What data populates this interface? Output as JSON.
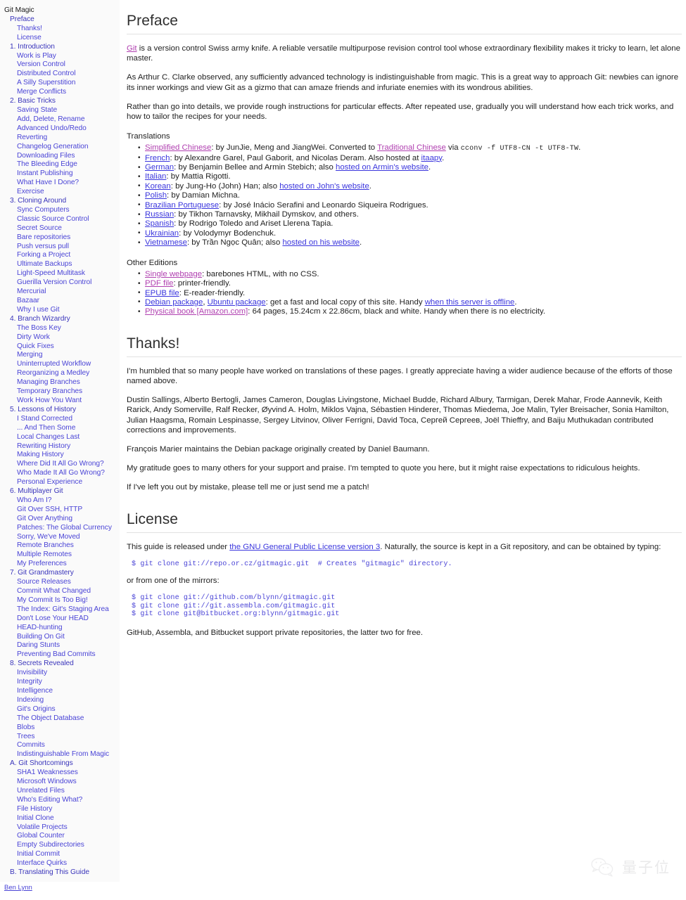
{
  "sidebar": {
    "root_label": "Git Magic",
    "items": [
      {
        "label": "Preface",
        "level": "chapter"
      },
      {
        "label": "Thanks!",
        "level": "section"
      },
      {
        "label": "License",
        "level": "section"
      },
      {
        "label": "1. Introduction",
        "level": "chapter"
      },
      {
        "label": "Work is Play",
        "level": "section"
      },
      {
        "label": "Version Control",
        "level": "section"
      },
      {
        "label": "Distributed Control",
        "level": "section"
      },
      {
        "label": "A Silly Superstition",
        "level": "section"
      },
      {
        "label": "Merge Conflicts",
        "level": "section"
      },
      {
        "label": "2. Basic Tricks",
        "level": "chapter"
      },
      {
        "label": "Saving State",
        "level": "section"
      },
      {
        "label": "Add, Delete, Rename",
        "level": "section"
      },
      {
        "label": "Advanced Undo/Redo",
        "level": "section"
      },
      {
        "label": "Reverting",
        "level": "section"
      },
      {
        "label": "Changelog Generation",
        "level": "section"
      },
      {
        "label": "Downloading Files",
        "level": "section"
      },
      {
        "label": "The Bleeding Edge",
        "level": "section"
      },
      {
        "label": "Instant Publishing",
        "level": "section"
      },
      {
        "label": "What Have I Done?",
        "level": "section"
      },
      {
        "label": "Exercise",
        "level": "section"
      },
      {
        "label": "3. Cloning Around",
        "level": "chapter"
      },
      {
        "label": "Sync Computers",
        "level": "section"
      },
      {
        "label": "Classic Source Control",
        "level": "section"
      },
      {
        "label": "Secret Source",
        "level": "section"
      },
      {
        "label": "Bare repositories",
        "level": "section"
      },
      {
        "label": "Push versus pull",
        "level": "section"
      },
      {
        "label": "Forking a Project",
        "level": "section"
      },
      {
        "label": "Ultimate Backups",
        "level": "section"
      },
      {
        "label": "Light-Speed Multitask",
        "level": "section"
      },
      {
        "label": "Guerilla Version Control",
        "level": "section"
      },
      {
        "label": "Mercurial",
        "level": "section"
      },
      {
        "label": "Bazaar",
        "level": "section"
      },
      {
        "label": "Why I use Git",
        "level": "section"
      },
      {
        "label": "4. Branch Wizardry",
        "level": "chapter"
      },
      {
        "label": "The Boss Key",
        "level": "section"
      },
      {
        "label": "Dirty Work",
        "level": "section"
      },
      {
        "label": "Quick Fixes",
        "level": "section"
      },
      {
        "label": "Merging",
        "level": "section"
      },
      {
        "label": "Uninterrupted Workflow",
        "level": "section"
      },
      {
        "label": "Reorganizing a Medley",
        "level": "section"
      },
      {
        "label": "Managing Branches",
        "level": "section"
      },
      {
        "label": "Temporary Branches",
        "level": "section"
      },
      {
        "label": "Work How You Want",
        "level": "section"
      },
      {
        "label": "5. Lessons of History",
        "level": "chapter"
      },
      {
        "label": "I Stand Corrected",
        "level": "section"
      },
      {
        "label": "... And Then Some",
        "level": "section"
      },
      {
        "label": "Local Changes Last",
        "level": "section"
      },
      {
        "label": "Rewriting History",
        "level": "section"
      },
      {
        "label": "Making History",
        "level": "section"
      },
      {
        "label": "Where Did It All Go Wrong?",
        "level": "section"
      },
      {
        "label": "Who Made It All Go Wrong?",
        "level": "section"
      },
      {
        "label": "Personal Experience",
        "level": "section"
      },
      {
        "label": "6. Multiplayer Git",
        "level": "chapter"
      },
      {
        "label": "Who Am I?",
        "level": "section"
      },
      {
        "label": "Git Over SSH, HTTP",
        "level": "section"
      },
      {
        "label": "Git Over Anything",
        "level": "section"
      },
      {
        "label": "Patches: The Global Currency",
        "level": "section"
      },
      {
        "label": "Sorry, We've Moved",
        "level": "section"
      },
      {
        "label": "Remote Branches",
        "level": "section"
      },
      {
        "label": "Multiple Remotes",
        "level": "section"
      },
      {
        "label": "My Preferences",
        "level": "section"
      },
      {
        "label": "7. Git Grandmastery",
        "level": "chapter"
      },
      {
        "label": "Source Releases",
        "level": "section"
      },
      {
        "label": "Commit What Changed",
        "level": "section"
      },
      {
        "label": "My Commit Is Too Big!",
        "level": "section"
      },
      {
        "label": "The Index: Git's Staging Area",
        "level": "section"
      },
      {
        "label": "Don't Lose Your HEAD",
        "level": "section"
      },
      {
        "label": "HEAD-hunting",
        "level": "section"
      },
      {
        "label": "Building On Git",
        "level": "section"
      },
      {
        "label": "Daring Stunts",
        "level": "section"
      },
      {
        "label": "Preventing Bad Commits",
        "level": "section"
      },
      {
        "label": "8. Secrets Revealed",
        "level": "chapter"
      },
      {
        "label": "Invisibility",
        "level": "section"
      },
      {
        "label": "Integrity",
        "level": "section"
      },
      {
        "label": "Intelligence",
        "level": "section"
      },
      {
        "label": "Indexing",
        "level": "section"
      },
      {
        "label": "Git's Origins",
        "level": "section"
      },
      {
        "label": "The Object Database",
        "level": "section"
      },
      {
        "label": "Blobs",
        "level": "section"
      },
      {
        "label": "Trees",
        "level": "section"
      },
      {
        "label": "Commits",
        "level": "section"
      },
      {
        "label": "Indistinguishable From Magic",
        "level": "section"
      },
      {
        "label": "A. Git Shortcomings",
        "level": "chapter"
      },
      {
        "label": "SHA1 Weaknesses",
        "level": "section"
      },
      {
        "label": "Microsoft Windows",
        "level": "section"
      },
      {
        "label": "Unrelated Files",
        "level": "section"
      },
      {
        "label": "Who's Editing What?",
        "level": "section"
      },
      {
        "label": "File History",
        "level": "section"
      },
      {
        "label": "Initial Clone",
        "level": "section"
      },
      {
        "label": "Volatile Projects",
        "level": "section"
      },
      {
        "label": "Global Counter",
        "level": "section"
      },
      {
        "label": "Empty Subdirectories",
        "level": "section"
      },
      {
        "label": "Initial Commit",
        "level": "section"
      },
      {
        "label": "Interface Quirks",
        "level": "section"
      },
      {
        "label": "B. Translating This Guide",
        "level": "chapter"
      }
    ],
    "byline": "Ben Lynn"
  },
  "preface": {
    "title": "Preface",
    "intro_link": "Git",
    "intro_rest": " is a version control Swiss army knife. A reliable versatile multipurpose revision control tool whose extraordinary flexibility makes it tricky to learn, let alone master.",
    "clarke_paragraph": "As Arthur C. Clarke observed, any sufficiently advanced technology is indistinguishable from magic. This is a great way to approach Git: newbies can ignore its inner workings and view Git as a gizmo that can amaze friends and infuriate enemies with its wondrous abilities.",
    "recipes_paragraph": "Rather than go into details, we provide rough instructions for particular effects. After repeated use, gradually you will understand how each trick works, and how to tailor the recipes for your needs.",
    "translations_heading": "Translations",
    "translations": [
      {
        "link": "Simplified Chinese",
        "visited": true,
        "mid": ": by JunJie, Meng and JiangWei. Converted to ",
        "link2": "Traditional Chinese",
        "visited2": true,
        "tail": " via ",
        "code": "cconv -f UTF8-CN -t UTF8-TW",
        "tail2": "."
      },
      {
        "link": "French",
        "visited": false,
        "mid": ": by Alexandre Garel, Paul Gaborit, and Nicolas Deram. Also hosted at ",
        "link2": "itaapy",
        "visited2": false,
        "tail": "."
      },
      {
        "link": "German",
        "visited": false,
        "mid": ": by Benjamin Bellee and Armin Stebich; also ",
        "link2": "hosted on Armin's website",
        "visited2": false,
        "tail": "."
      },
      {
        "link": "Italian",
        "visited": false,
        "mid": ": by Mattia Rigotti."
      },
      {
        "link": "Korean",
        "visited": false,
        "mid": ": by Jung-Ho (John) Han; also ",
        "link2": "hosted on John's website",
        "visited2": false,
        "tail": "."
      },
      {
        "link": "Polish",
        "visited": false,
        "mid": ": by Damian Michna."
      },
      {
        "link": "Brazilian Portuguese",
        "visited": false,
        "mid": ": by José Inácio Serafini and Leonardo Siqueira Rodrigues."
      },
      {
        "link": "Russian",
        "visited": false,
        "mid": ": by Tikhon Tarnavsky, Mikhail Dymskov, and others."
      },
      {
        "link": "Spanish",
        "visited": false,
        "mid": ": by Rodrigo Toledo and Ariset Llerena Tapia."
      },
      {
        "link": "Ukrainian",
        "visited": false,
        "mid": ": by Volodymyr Bodenchuk."
      },
      {
        "link": "Vietnamese",
        "visited": false,
        "mid": ": by Trần Ngọc Quân; also ",
        "link2": "hosted on his website",
        "visited2": false,
        "tail": "."
      }
    ],
    "other_editions_heading": "Other Editions",
    "other_editions": [
      {
        "link": "Single webpage",
        "visited": true,
        "mid": ": barebones HTML, with no CSS."
      },
      {
        "link": "PDF file",
        "visited": true,
        "mid": ": printer-friendly."
      },
      {
        "link": "EPUB file",
        "visited": false,
        "mid": ": E-reader-friendly."
      },
      {
        "link": "Debian package",
        "visited": false,
        "mid": ", ",
        "link2": "Ubuntu package",
        "visited2": false,
        "tail": ": get a fast and local copy of this site. Handy ",
        "link3": "when this server is offline",
        "visited3": false,
        "tail2": "."
      },
      {
        "link": "Physical book [Amazon.com]",
        "visited": true,
        "mid": ": 64 pages, 15.24cm x 22.86cm, black and white. Handy when there is no electricity."
      }
    ]
  },
  "thanks": {
    "title": "Thanks!",
    "p1": "I'm humbled that so many people have worked on translations of these pages. I greatly appreciate having a wider audience because of the efforts of those named above.",
    "p2": "Dustin Sallings, Alberto Bertogli, James Cameron, Douglas Livingstone, Michael Budde, Richard Albury, Tarmigan, Derek Mahar, Frode Aannevik, Keith Rarick, Andy Somerville, Ralf Recker, Øyvind A. Holm, Miklos Vajna, Sébastien Hinderer, Thomas Miedema, Joe Malin, Tyler Breisacher, Sonia Hamilton, Julian Haagsma, Romain Lespinasse, Sergey Litvinov, Oliver Ferrigni, David Toca, Сергей Сергеев, Joël Thieffry, and Baiju Muthukadan contributed corrections and improvements.",
    "p3": "François Marier maintains the Debian package originally created by Daniel Baumann.",
    "p4": "My gratitude goes to many others for your support and praise. I'm tempted to quote you here, but it might raise expectations to ridiculous heights.",
    "p5": "If I've left you out by mistake, please tell me or just send me a patch!"
  },
  "license": {
    "title": "License",
    "lead_before": "This guide is released under ",
    "lead_link": "the GNU General Public License version 3",
    "lead_after": ". Naturally, the source is kept in a Git repository, and can be obtained by typing:",
    "code_main": "$ git clone git://repo.or.cz/gitmagic.git  # Creates \"gitmagic\" directory.",
    "mirrors_lead": "or from one of the mirrors:",
    "code_mirrors": "$ git clone git://github.com/blynn/gitmagic.git\n$ git clone git://git.assembla.com/gitmagic.git\n$ git clone git@bitbucket.org:blynn/gitmagic.git",
    "closing": "GitHub, Assembla, and Bitbucket support private repositories, the latter two for free."
  },
  "watermark": {
    "text": "量子位",
    "icon": "wechat-bubbles-icon"
  },
  "colors": {
    "link": "#3a35dd",
    "link_visited": "#b03fb0",
    "sidebar_bg": "#fafafa",
    "code": "#4a44d6"
  }
}
